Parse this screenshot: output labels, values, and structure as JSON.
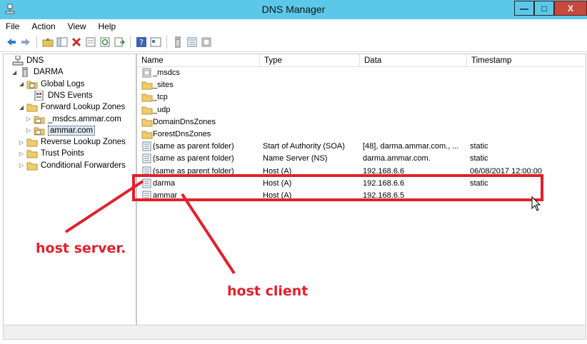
{
  "window": {
    "title": "DNS Manager",
    "min_label": "—",
    "max_label": "□",
    "close_label": "X"
  },
  "menu": [
    "File",
    "Action",
    "View",
    "Help"
  ],
  "toolbar": {
    "icons": [
      "back-arrow-icon",
      "forward-arrow-icon",
      "up-folder-icon",
      "show-hide-tree-icon",
      "delete-icon",
      "properties-icon",
      "refresh-icon",
      "export-icon",
      "help-icon",
      "console-tree-icon",
      "server-icon",
      "list-icon",
      "details-icon"
    ]
  },
  "tree": [
    {
      "label": "DNS",
      "indent": 0,
      "expander": "",
      "icon": "dns-icon"
    },
    {
      "label": "DARMA",
      "indent": 1,
      "expander": "◢",
      "icon": "server-icon"
    },
    {
      "label": "Global Logs",
      "indent": 2,
      "expander": "◢",
      "icon": "log-folder-icon"
    },
    {
      "label": "DNS Events",
      "indent": 3,
      "expander": "",
      "icon": "event-log-icon"
    },
    {
      "label": "Forward Lookup Zones",
      "indent": 2,
      "expander": "◢",
      "icon": "folder-icon"
    },
    {
      "label": "_msdcs.ammar.com",
      "indent": 3,
      "expander": "▷",
      "icon": "zone-icon"
    },
    {
      "label": "ammar.com",
      "indent": 3,
      "expander": "▷",
      "icon": "zone-icon",
      "selected": true
    },
    {
      "label": "Reverse Lookup Zones",
      "indent": 2,
      "expander": "▷",
      "icon": "folder-icon"
    },
    {
      "label": "Trust Points",
      "indent": 2,
      "expander": "▷",
      "icon": "folder-icon"
    },
    {
      "label": "Conditional Forwarders",
      "indent": 2,
      "expander": "▷",
      "icon": "folder-icon"
    }
  ],
  "columns": [
    "Name",
    "Type",
    "Data",
    "Timestamp"
  ],
  "rows": [
    {
      "name": "_msdcs",
      "type": "",
      "data": "",
      "timestamp": "",
      "icon": "delegated-zone-icon"
    },
    {
      "name": "_sites",
      "type": "",
      "data": "",
      "timestamp": "",
      "icon": "folder-icon"
    },
    {
      "name": "_tcp",
      "type": "",
      "data": "",
      "timestamp": "",
      "icon": "folder-icon"
    },
    {
      "name": "_udp",
      "type": "",
      "data": "",
      "timestamp": "",
      "icon": "folder-icon"
    },
    {
      "name": "DomainDnsZones",
      "type": "",
      "data": "",
      "timestamp": "",
      "icon": "folder-icon"
    },
    {
      "name": "ForestDnsZones",
      "type": "",
      "data": "",
      "timestamp": "",
      "icon": "folder-icon"
    },
    {
      "name": "(same as parent folder)",
      "type": "Start of Authority (SOA)",
      "data": "[48], darma.ammar.com., ...",
      "timestamp": "static",
      "icon": "record-icon"
    },
    {
      "name": "(same as parent folder)",
      "type": "Name Server (NS)",
      "data": "darma.ammar.com.",
      "timestamp": "static",
      "icon": "record-icon"
    },
    {
      "name": "(same as parent folder)",
      "type": "Host (A)",
      "data": "192.168.6.6",
      "timestamp": "06/08/2017 12:00:00",
      "icon": "record-icon"
    },
    {
      "name": "darma",
      "type": "Host (A)",
      "data": "192.168.6.6",
      "timestamp": "static",
      "icon": "record-icon"
    },
    {
      "name": "ammar",
      "type": "Host (A)",
      "data": "192.168.6.5",
      "timestamp": "",
      "icon": "record-icon"
    }
  ],
  "annotations": {
    "server": "host server.",
    "client": "host client",
    "color": "#e2202b"
  },
  "colors": {
    "titlebar": "#5bc8ea",
    "close": "#c7493e",
    "selection": "#dceaf5"
  }
}
